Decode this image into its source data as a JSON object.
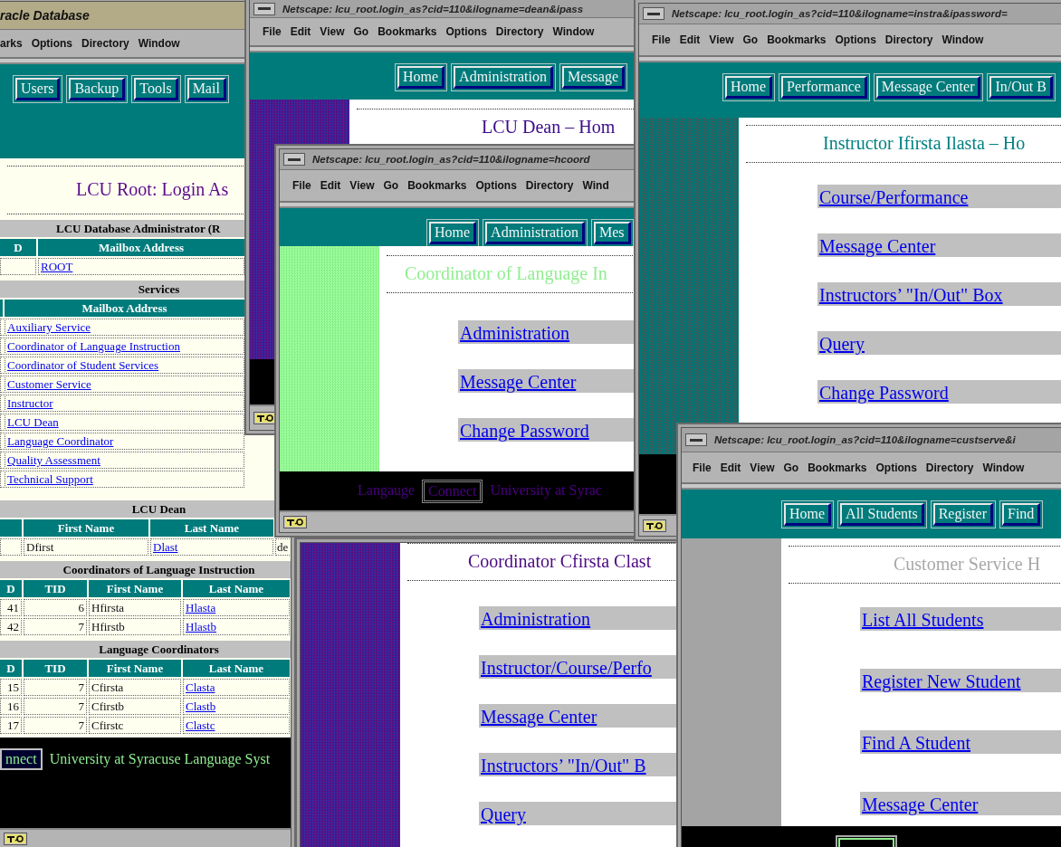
{
  "windows": [
    {
      "kind": "oracle",
      "title": "racle Database",
      "menu": [
        "arks",
        "Options",
        "Directory",
        "Window"
      ],
      "nav": [
        "Users",
        "Backup",
        "Tools",
        "Mail"
      ],
      "heading": "LCU Root: Login As",
      "tables": [
        {
          "caption": "LCU Database Administrator (R",
          "columns": [
            {
              "kind": "head",
              "text": "D"
            },
            {
              "kind": "head",
              "text": "Mailbox Address"
            }
          ],
          "rows": [
            [
              {
                "kind": "blank"
              },
              {
                "kind": "link",
                "text": "ROOT"
              }
            ]
          ]
        },
        {
          "caption": "Services",
          "columns": [
            {
              "kind": "blank"
            },
            {
              "kind": "head",
              "text": "Mailbox Address"
            }
          ],
          "rows": [
            [
              {
                "kind": "blank"
              },
              {
                "kind": "link",
                "text": "Auxiliary Service"
              }
            ],
            [
              {
                "kind": "blank"
              },
              {
                "kind": "link",
                "text": "Coordinator of Language Instruction"
              }
            ],
            [
              {
                "kind": "blank"
              },
              {
                "kind": "link",
                "text": "Coordinator of Student Services"
              }
            ],
            [
              {
                "kind": "blank"
              },
              {
                "kind": "link",
                "text": "Customer Service"
              }
            ],
            [
              {
                "kind": "blank"
              },
              {
                "kind": "link",
                "text": "Instructor"
              }
            ],
            [
              {
                "kind": "blank"
              },
              {
                "kind": "link",
                "text": "LCU Dean"
              }
            ],
            [
              {
                "kind": "blank"
              },
              {
                "kind": "link",
                "text": "Language Coordinator"
              }
            ],
            [
              {
                "kind": "blank"
              },
              {
                "kind": "link",
                "text": "Quality Assessment"
              }
            ],
            [
              {
                "kind": "blank"
              },
              {
                "kind": "link",
                "text": "Technical Support"
              }
            ]
          ]
        },
        {
          "caption": "LCU Dean",
          "columns": [
            {
              "kind": "blank"
            },
            {
              "kind": "head",
              "text": "First Name"
            },
            {
              "kind": "head",
              "text": "Last Name"
            },
            {
              "kind": "blank"
            }
          ],
          "rows": [
            [
              {
                "kind": "blank"
              },
              {
                "kind": "text",
                "text": "Dfirst"
              },
              {
                "kind": "link",
                "text": "Dlast"
              },
              {
                "kind": "text",
                "text": "de"
              }
            ]
          ]
        },
        {
          "caption": "Coordinators of Language Instruction",
          "columns": [
            {
              "kind": "head",
              "text": "D"
            },
            {
              "kind": "head",
              "text": "TID"
            },
            {
              "kind": "head",
              "text": "First Name"
            },
            {
              "kind": "head",
              "text": "Last Name"
            }
          ],
          "rows": [
            [
              {
                "kind": "number",
                "text": "41"
              },
              {
                "kind": "number",
                "text": "6"
              },
              {
                "kind": "text",
                "text": "Hfirsta"
              },
              {
                "kind": "link",
                "text": "Hlasta"
              }
            ],
            [
              {
                "kind": "number",
                "text": "42"
              },
              {
                "kind": "number",
                "text": "7"
              },
              {
                "kind": "text",
                "text": "Hfirstb"
              },
              {
                "kind": "link",
                "text": "Hlastb"
              }
            ]
          ]
        },
        {
          "caption": "Language Coordinators",
          "columns": [
            {
              "kind": "head",
              "text": "D"
            },
            {
              "kind": "head",
              "text": "TID"
            },
            {
              "kind": "head",
              "text": "First Name"
            },
            {
              "kind": "head",
              "text": "Last Name"
            }
          ],
          "rows": [
            [
              {
                "kind": "number",
                "text": "15"
              },
              {
                "kind": "number",
                "text": "7"
              },
              {
                "kind": "text",
                "text": "Cfirsta"
              },
              {
                "kind": "link",
                "text": "Clasta"
              }
            ],
            [
              {
                "kind": "number",
                "text": "16"
              },
              {
                "kind": "number",
                "text": "7"
              },
              {
                "kind": "text",
                "text": "Cfirstb"
              },
              {
                "kind": "link",
                "text": "Clastb"
              }
            ],
            [
              {
                "kind": "number",
                "text": "17"
              },
              {
                "kind": "number",
                "text": "7"
              },
              {
                "kind": "text",
                "text": "Cfirstc"
              },
              {
                "kind": "link",
                "text": "Clastc"
              }
            ]
          ]
        }
      ],
      "footer": {
        "button": "nnect",
        "text": "University at Syracuse Language Syst"
      }
    },
    {
      "kind": "browser",
      "title": "Netscape: lcu_root.login_as?cid=110&ilogname=dean&ipass",
      "menu": [
        "File",
        "Edit",
        "View",
        "Go",
        "Bookmarks",
        "Options",
        "Directory",
        "Window"
      ],
      "nav": [
        "Home",
        "Administration",
        "Message"
      ],
      "heading": "LCU Dean – Hom"
    },
    {
      "kind": "browser",
      "title": "Netscape: lcu_root.login_as?cid=110&ilogname=hcoord",
      "menu": [
        "File",
        "Edit",
        "View",
        "Go",
        "Bookmarks",
        "Options",
        "Directory",
        "Wind"
      ],
      "nav": [
        "Home",
        "Administration",
        "Mes"
      ],
      "heading": "Coordinator of Language In",
      "links": [
        "Administration",
        "Message Center",
        "Change Password"
      ],
      "footer": {
        "label": "Langauge",
        "button": "Connect",
        "text": "University at Syrac"
      }
    },
    {
      "kind": "partial",
      "heading": "Coordinator Cfirsta Clast",
      "links": [
        "Administration",
        "Instructor/Course/Perfo",
        "Message Center",
        "Instructors’ \"In/Out\" B",
        "Query"
      ]
    },
    {
      "kind": "browser",
      "title": "Netscape: lcu_root.login_as?cid=110&ilogname=instra&ipassword=",
      "menu": [
        "File",
        "Edit",
        "View",
        "Go",
        "Bookmarks",
        "Options",
        "Directory",
        "Window"
      ],
      "nav": [
        "Home",
        "Performance",
        "Message Center",
        "In/Out B"
      ],
      "heading": "Instructor Ifirsta Ilasta – Ho",
      "links": [
        "Course/Performance",
        "Message Center",
        "Instructors’ \"In/Out\" Box",
        "Query",
        "Change Password"
      ]
    },
    {
      "kind": "browser",
      "title": "Netscape: lcu_root.login_as?cid=110&ilogname=custserve&i",
      "menu": [
        "File",
        "Edit",
        "View",
        "Go",
        "Bookmarks",
        "Options",
        "Directory",
        "Window"
      ],
      "nav": [
        "Home",
        "All Students",
        "Register",
        "Find"
      ],
      "heading": "Customer Service H",
      "links": [
        "List All Students",
        "Register New Student",
        "Find A Student",
        "Message Center"
      ],
      "footer": {
        "kind": "empty_button"
      }
    }
  ]
}
